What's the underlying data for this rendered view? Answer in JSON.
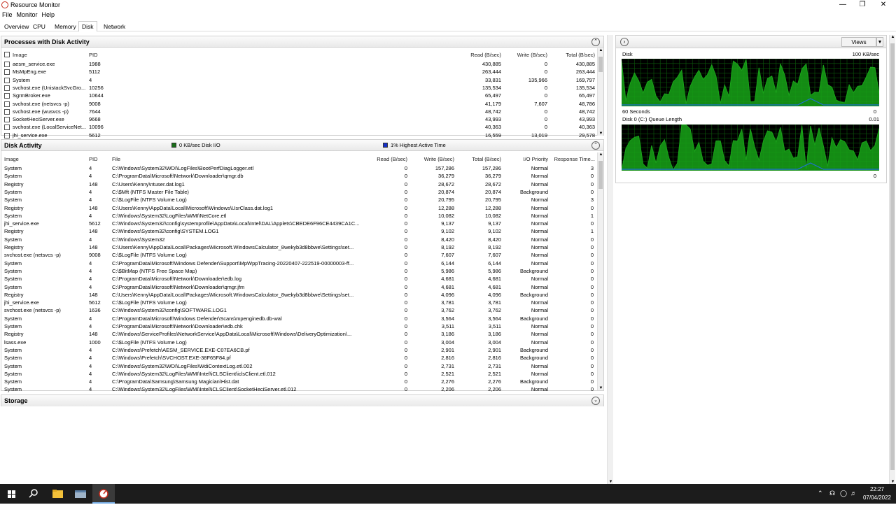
{
  "window": {
    "title": "Resource Monitor"
  },
  "menu": [
    "File",
    "Monitor",
    "Help"
  ],
  "tabs": [
    "Overview",
    "CPU",
    "Memory",
    "Disk",
    "Network"
  ],
  "processes": {
    "title": "Processes with Disk Activity",
    "headers": {
      "image": "Image",
      "pid": "PID",
      "read": "Read (B/sec)",
      "write": "Write (B/sec)",
      "total": "Total (B/sec)"
    },
    "rows": [
      {
        "image": "aesm_service.exe",
        "pid": "1988",
        "read": "430,885",
        "write": "0",
        "total": "430,885"
      },
      {
        "image": "MsMpEng.exe",
        "pid": "5112",
        "read": "263,444",
        "write": "0",
        "total": "263,444"
      },
      {
        "image": "System",
        "pid": "4",
        "read": "33,831",
        "write": "135,966",
        "total": "169,797"
      },
      {
        "image": "svchost.exe (UnistackSvcGro...",
        "pid": "10256",
        "read": "135,534",
        "write": "0",
        "total": "135,534"
      },
      {
        "image": "SgrmBroker.exe",
        "pid": "10644",
        "read": "65,497",
        "write": "0",
        "total": "65,497"
      },
      {
        "image": "svchost.exe (netsvcs -p)",
        "pid": "9008",
        "read": "41,179",
        "write": "7,607",
        "total": "48,786"
      },
      {
        "image": "svchost.exe (wusvcs -p)",
        "pid": "7644",
        "read": "48,742",
        "write": "0",
        "total": "48,742"
      },
      {
        "image": "SocketHeciServer.exe",
        "pid": "9668",
        "read": "43,993",
        "write": "0",
        "total": "43,993"
      },
      {
        "image": "svchost.exe (LocalServiceNet...",
        "pid": "10096",
        "read": "40,363",
        "write": "0",
        "total": "40,363"
      },
      {
        "image": "jhi_service.exe",
        "pid": "5612",
        "read": "16,559",
        "write": "13,019",
        "total": "29,578"
      }
    ]
  },
  "disk_activity": {
    "title": "Disk Activity",
    "legend1": "0 KB/sec Disk I/O",
    "legend2": "1% Highest Active Time",
    "legend1_color": "#1a6e1a",
    "legend2_color": "#1530c8",
    "headers": {
      "image": "Image",
      "pid": "PID",
      "file": "File",
      "read": "Read (B/sec)",
      "write": "Write (B/sec)",
      "total": "Total (B/sec)",
      "prio": "I/O Priority",
      "resp": "Response Time..."
    },
    "rows": [
      {
        "image": "System",
        "pid": "4",
        "file": "C:\\Windows\\System32\\WDI\\LogFiles\\BootPerfDiagLogger.etl",
        "read": "0",
        "write": "157,286",
        "total": "157,286",
        "prio": "Normal",
        "resp": "3"
      },
      {
        "image": "System",
        "pid": "4",
        "file": "C:\\ProgramData\\Microsoft\\Network\\Downloader\\qmgr.db",
        "read": "0",
        "write": "36,279",
        "total": "36,279",
        "prio": "Normal",
        "resp": "0"
      },
      {
        "image": "Registry",
        "pid": "148",
        "file": "C:\\Users\\Kenny\\ntuser.dat.log1",
        "read": "0",
        "write": "28,672",
        "total": "28,672",
        "prio": "Normal",
        "resp": "0"
      },
      {
        "image": "System",
        "pid": "4",
        "file": "C:\\$Mft (NTFS Master File Table)",
        "read": "0",
        "write": "20,874",
        "total": "20,874",
        "prio": "Background",
        "resp": "0"
      },
      {
        "image": "System",
        "pid": "4",
        "file": "C:\\$LogFile (NTFS Volume Log)",
        "read": "0",
        "write": "20,795",
        "total": "20,795",
        "prio": "Normal",
        "resp": "3"
      },
      {
        "image": "Registry",
        "pid": "148",
        "file": "C:\\Users\\Kenny\\AppData\\Local\\Microsoft\\Windows\\UsrClass.dat.log1",
        "read": "0",
        "write": "12,288",
        "total": "12,288",
        "prio": "Normal",
        "resp": "0"
      },
      {
        "image": "System",
        "pid": "4",
        "file": "C:\\Windows\\System32\\LogFiles\\WMI\\NetCore.etl",
        "read": "0",
        "write": "10,082",
        "total": "10,082",
        "prio": "Normal",
        "resp": "1"
      },
      {
        "image": "jhi_service.exe",
        "pid": "5612",
        "file": "C:\\Windows\\System32\\config\\systemprofile\\AppData\\Local\\Intel\\DAL\\Applets\\CBEDE6F96CE4439CA1C...",
        "read": "0",
        "write": "9,137",
        "total": "9,137",
        "prio": "Normal",
        "resp": "0"
      },
      {
        "image": "Registry",
        "pid": "148",
        "file": "C:\\Windows\\System32\\config\\SYSTEM.LOG1",
        "read": "0",
        "write": "9,102",
        "total": "9,102",
        "prio": "Normal",
        "resp": "1"
      },
      {
        "image": "System",
        "pid": "4",
        "file": "C:\\Windows\\System32",
        "read": "0",
        "write": "8,420",
        "total": "8,420",
        "prio": "Normal",
        "resp": "0"
      },
      {
        "image": "Registry",
        "pid": "148",
        "file": "C:\\Users\\Kenny\\AppData\\Local\\Packages\\Microsoft.WindowsCalculator_8wekyb3d8bbwe\\Settings\\set...",
        "read": "0",
        "write": "8,192",
        "total": "8,192",
        "prio": "Normal",
        "resp": "0"
      },
      {
        "image": "svchost.exe (netsvcs -p)",
        "pid": "9008",
        "file": "C:\\$LogFile (NTFS Volume Log)",
        "read": "0",
        "write": "7,607",
        "total": "7,607",
        "prio": "Normal",
        "resp": "0"
      },
      {
        "image": "System",
        "pid": "4",
        "file": "C:\\ProgramData\\Microsoft\\Windows Defender\\Support\\MpWppTracing-20220407-222519-00000003-ff...",
        "read": "0",
        "write": "6,144",
        "total": "6,144",
        "prio": "Normal",
        "resp": "0"
      },
      {
        "image": "System",
        "pid": "4",
        "file": "C:\\$BitMap (NTFS Free Space Map)",
        "read": "0",
        "write": "5,986",
        "total": "5,986",
        "prio": "Background",
        "resp": "0"
      },
      {
        "image": "System",
        "pid": "4",
        "file": "C:\\ProgramData\\Microsoft\\Network\\Downloader\\edb.log",
        "read": "0",
        "write": "4,681",
        "total": "4,681",
        "prio": "Normal",
        "resp": "0"
      },
      {
        "image": "System",
        "pid": "4",
        "file": "C:\\ProgramData\\Microsoft\\Network\\Downloader\\qmgr.jfm",
        "read": "0",
        "write": "4,681",
        "total": "4,681",
        "prio": "Normal",
        "resp": "0"
      },
      {
        "image": "Registry",
        "pid": "148",
        "file": "C:\\Users\\Kenny\\AppData\\Local\\Packages\\Microsoft.WindowsCalculator_8wekyb3d8bbwe\\Settings\\set...",
        "read": "0",
        "write": "4,096",
        "total": "4,096",
        "prio": "Background",
        "resp": "0"
      },
      {
        "image": "jhi_service.exe",
        "pid": "5612",
        "file": "C:\\$LogFile (NTFS Volume Log)",
        "read": "0",
        "write": "3,781",
        "total": "3,781",
        "prio": "Normal",
        "resp": "0"
      },
      {
        "image": "svchost.exe (netsvcs -p)",
        "pid": "1636",
        "file": "C:\\Windows\\System32\\config\\SOFTWARE.LOG1",
        "read": "0",
        "write": "3,762",
        "total": "3,762",
        "prio": "Normal",
        "resp": "0"
      },
      {
        "image": "System",
        "pid": "4",
        "file": "C:\\ProgramData\\Microsoft\\Windows Defender\\Scans\\mpenginedb.db-wal",
        "read": "0",
        "write": "3,564",
        "total": "3,564",
        "prio": "Background",
        "resp": "0"
      },
      {
        "image": "System",
        "pid": "4",
        "file": "C:\\ProgramData\\Microsoft\\Network\\Downloader\\edb.chk",
        "read": "0",
        "write": "3,511",
        "total": "3,511",
        "prio": "Normal",
        "resp": "0"
      },
      {
        "image": "Registry",
        "pid": "148",
        "file": "C:\\Windows\\ServiceProfiles\\NetworkService\\AppData\\Local\\Microsoft\\Windows\\DeliveryOptimization\\...",
        "read": "0",
        "write": "3,186",
        "total": "3,186",
        "prio": "Normal",
        "resp": "0"
      },
      {
        "image": "lsass.exe",
        "pid": "1000",
        "file": "C:\\$LogFile (NTFS Volume Log)",
        "read": "0",
        "write": "3,004",
        "total": "3,004",
        "prio": "Normal",
        "resp": "0"
      },
      {
        "image": "System",
        "pid": "4",
        "file": "C:\\Windows\\Prefetch\\AESM_SERVICE.EXE-C07EA6CB.pf",
        "read": "0",
        "write": "2,901",
        "total": "2,901",
        "prio": "Background",
        "resp": "0"
      },
      {
        "image": "System",
        "pid": "4",
        "file": "C:\\Windows\\Prefetch\\SVCHOST.EXE-38F65F84.pf",
        "read": "0",
        "write": "2,816",
        "total": "2,816",
        "prio": "Background",
        "resp": "0"
      },
      {
        "image": "System",
        "pid": "4",
        "file": "C:\\Windows\\System32\\WDI\\LogFiles\\WdiContextLog.etl.002",
        "read": "0",
        "write": "2,731",
        "total": "2,731",
        "prio": "Normal",
        "resp": "0"
      },
      {
        "image": "System",
        "pid": "4",
        "file": "C:\\Windows\\System32\\LogFiles\\WMI\\Intel\\iCLSClient\\iclsClient.etl.012",
        "read": "0",
        "write": "2,521",
        "total": "2,521",
        "prio": "Normal",
        "resp": "0"
      },
      {
        "image": "System",
        "pid": "4",
        "file": "C:\\ProgramData\\Samsung\\Samsung Magician\\Hist.dat",
        "read": "0",
        "write": "2,276",
        "total": "2,276",
        "prio": "Background",
        "resp": "0"
      },
      {
        "image": "System",
        "pid": "4",
        "file": "C:\\Windows\\System32\\LogFiles\\WMI\\Intel\\iCLSClient\\SocketHeciServer.etl.012",
        "read": "0",
        "write": "2,206",
        "total": "2,206",
        "prio": "Normal",
        "resp": "0"
      }
    ]
  },
  "storage": {
    "title": "Storage"
  },
  "right": {
    "views_label": "Views",
    "graph1": {
      "title": "Disk",
      "scale": "100 KB/sec",
      "time": "60 Seconds",
      "min": "0"
    },
    "graph2": {
      "title": "Disk 0 (C:) Queue Length",
      "scale": "0.01",
      "min": "0"
    },
    "graph_line_color": "#1aa31a",
    "graph_fill_color": "#17a317",
    "graph_secondary_color": "#1f6fd6"
  },
  "taskbar": {
    "time": "22:27",
    "date": "07/04/2022"
  }
}
